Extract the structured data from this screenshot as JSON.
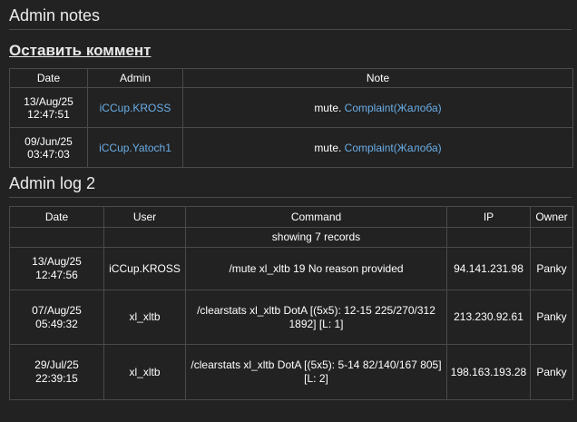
{
  "admin_notes": {
    "heading": "Admin notes",
    "add_comment_label": "Оставить коммент",
    "columns": [
      "Date",
      "Admin",
      "Note"
    ],
    "rows": [
      {
        "date": "13/Aug/25",
        "time": "12:47:51",
        "admin": "iCCup.KROSS",
        "note_prefix": "mute.",
        "note_link": "Complaint(Жалоба)"
      },
      {
        "date": "09/Jun/25",
        "time": "03:47:03",
        "admin": "iCCup.Yatoch1",
        "note_prefix": "mute.",
        "note_link": "Complaint(Жалоба)"
      }
    ]
  },
  "admin_log": {
    "heading": "Admin log 2",
    "columns": [
      "Date",
      "User",
      "Command",
      "IP",
      "Owner"
    ],
    "summary": "showing 7 records",
    "rows": [
      {
        "date": "13/Aug/25",
        "time": "12:47:56",
        "user": "iCCup.KROSS",
        "command": "/mute xl_xltb 19 No reason provided",
        "ip": "94.141.231.98",
        "owner": "Panky"
      },
      {
        "date": "07/Aug/25",
        "time": "05:49:32",
        "user": "xl_xltb",
        "command": "/clearstats xl_xltb DotA [(5x5): 12-15 225/270/312 1892] [L: 1]",
        "ip": "213.230.92.61",
        "owner": "Panky"
      },
      {
        "date": "29/Jul/25",
        "time": "22:39:15",
        "user": "xl_xltb",
        "command": "/clearstats xl_xltb DotA [(5x5): 5-14 82/140/167 805] [L: 2]",
        "ip": "198.163.193.28",
        "owner": "Panky"
      }
    ]
  }
}
